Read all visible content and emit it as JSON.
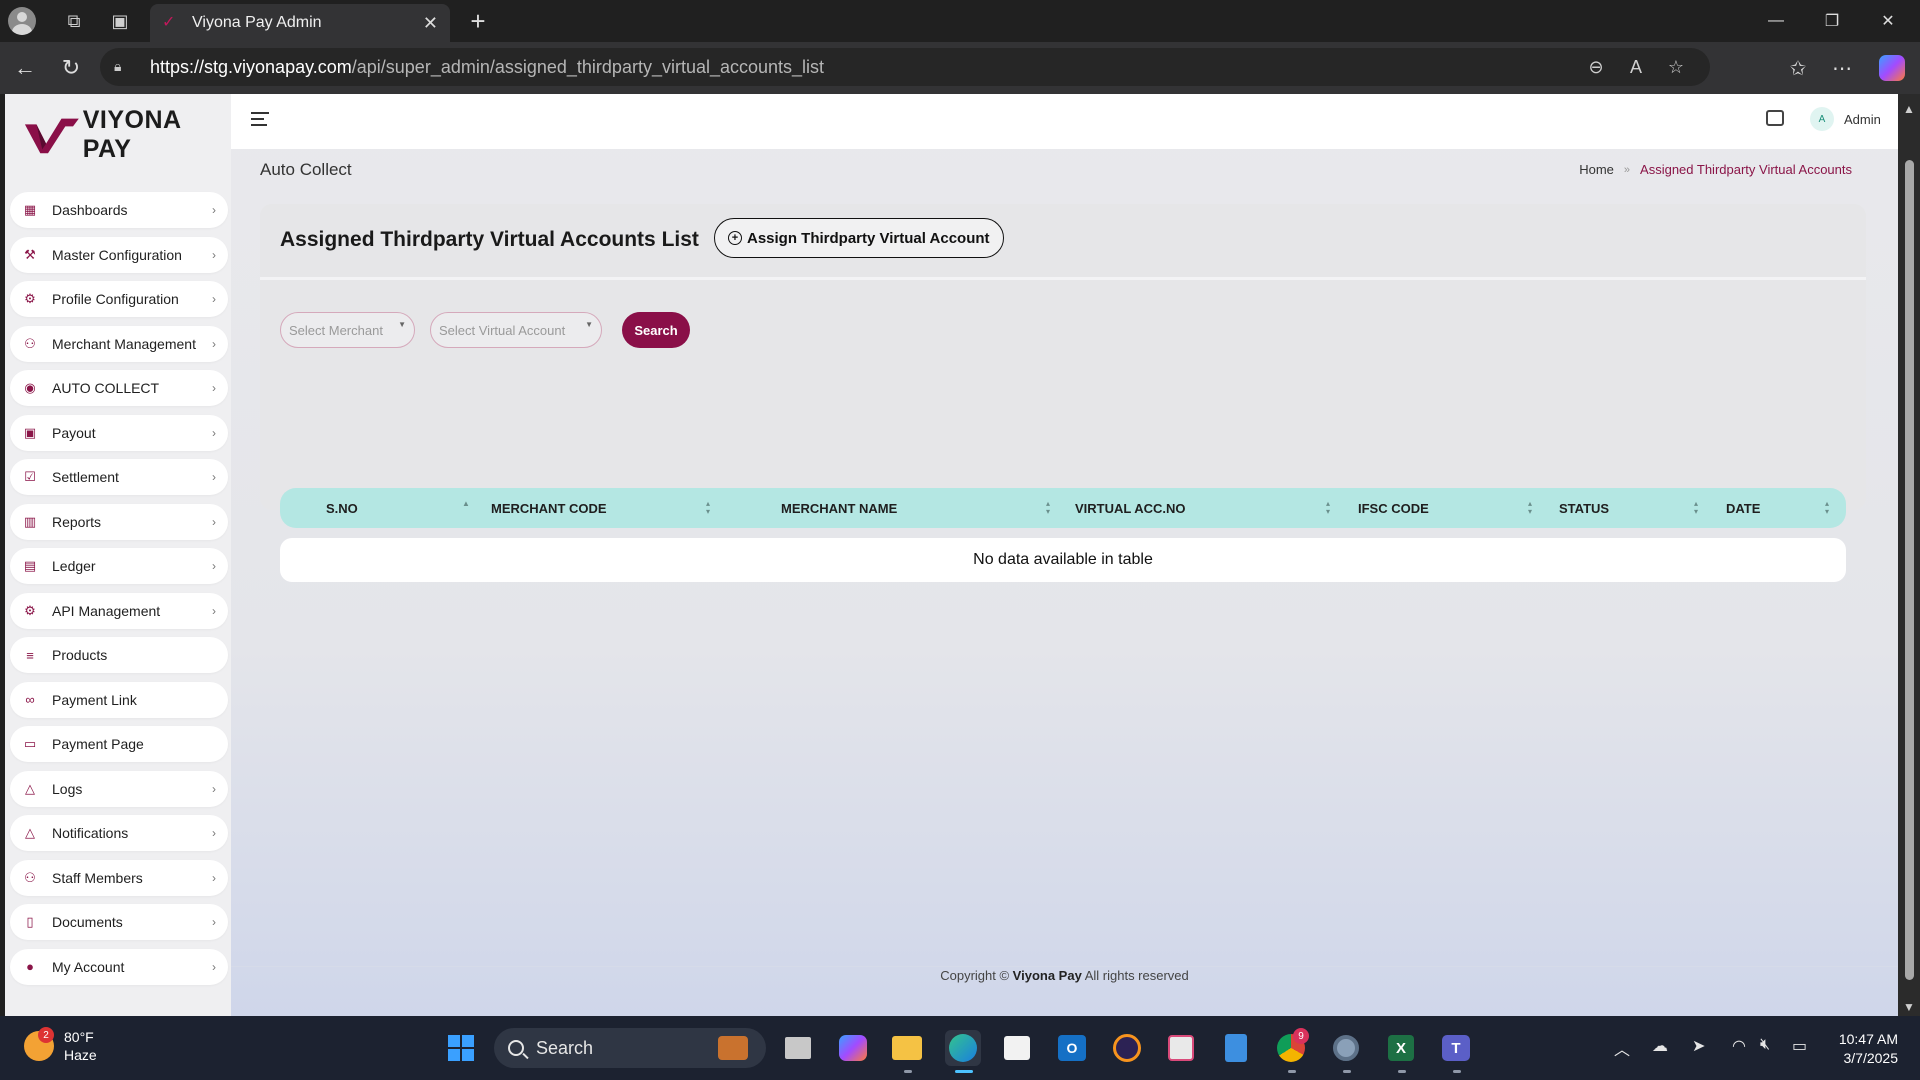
{
  "browser": {
    "tab_title": "Viyona Pay Admin",
    "url_host": "https://stg.viyonapay.com",
    "url_path": "/api/super_admin/assigned_thirdparty_virtual_accounts_list"
  },
  "brand": {
    "name": "VIYONA PAY",
    "accent": "#8a0f48"
  },
  "sidebar": {
    "items": [
      {
        "label": "Dashboards",
        "icon": "grid-icon",
        "glyph": "▦",
        "has_submenu": true
      },
      {
        "label": "Master Configuration",
        "icon": "wrench-icon",
        "glyph": "⚒",
        "has_submenu": true
      },
      {
        "label": "Profile Configuration",
        "icon": "gear-icon",
        "glyph": "⚙",
        "has_submenu": true
      },
      {
        "label": "Merchant Management",
        "icon": "users-icon",
        "glyph": "⚇",
        "has_submenu": true
      },
      {
        "label": "AUTO COLLECT",
        "icon": "refresh-icon",
        "glyph": "◉",
        "has_submenu": true
      },
      {
        "label": "Payout",
        "icon": "payout-icon",
        "glyph": "▣",
        "has_submenu": true
      },
      {
        "label": "Settlement",
        "icon": "calendar-check-icon",
        "glyph": "☑",
        "has_submenu": true
      },
      {
        "label": "Reports",
        "icon": "bar-chart-icon",
        "glyph": "▥",
        "has_submenu": true
      },
      {
        "label": "Ledger",
        "icon": "ledger-icon",
        "glyph": "▤",
        "has_submenu": true
      },
      {
        "label": "API Management",
        "icon": "cog-icon",
        "glyph": "⚙",
        "has_submenu": true
      },
      {
        "label": "Products",
        "icon": "list-plus-icon",
        "glyph": "≡",
        "has_submenu": false
      },
      {
        "label": "Payment Link",
        "icon": "link-icon",
        "glyph": "∞",
        "has_submenu": false
      },
      {
        "label": "Payment Page",
        "icon": "page-icon",
        "glyph": "▭",
        "has_submenu": false
      },
      {
        "label": "Logs",
        "icon": "bell-icon",
        "glyph": "△",
        "has_submenu": true
      },
      {
        "label": "Notifications",
        "icon": "bell-icon",
        "glyph": "△",
        "has_submenu": true
      },
      {
        "label": "Staff Members",
        "icon": "users-icon",
        "glyph": "⚇",
        "has_submenu": true
      },
      {
        "label": "Documents",
        "icon": "document-icon",
        "glyph": "▯",
        "has_submenu": true
      },
      {
        "label": "My Account",
        "icon": "user-circle-icon",
        "glyph": "●",
        "has_submenu": true
      }
    ]
  },
  "header": {
    "avatar_initial": "A",
    "user_name": "Admin"
  },
  "page": {
    "section_title": "Auto Collect",
    "breadcrumb": {
      "home": "Home",
      "current": "Assigned Thirdparty Virtual Accounts"
    },
    "card_title": "Assigned Thirdparty Virtual Accounts List",
    "assign_button": "Assign Thirdparty Virtual Account",
    "filters": {
      "merchant_placeholder": "Select Merchant",
      "virtual_account_placeholder": "Select Virtual Account",
      "search_label": "Search"
    },
    "table": {
      "columns": [
        "S.NO",
        "MERCHANT CODE",
        "MERCHANT NAME",
        "VIRTUAL ACC.NO",
        "IFSC CODE",
        "STATUS",
        "DATE"
      ],
      "empty_message": "No data available in table"
    }
  },
  "footer": {
    "prefix": "Copyright ©",
    "brand": "Viyona Pay",
    "suffix": "All rights reserved"
  },
  "taskbar": {
    "weather_temp": "80°F",
    "weather_desc": "Haze",
    "weather_badge": "2",
    "search_label": "Search",
    "chrome_badge": "9",
    "time": "10:47 AM",
    "date": "3/7/2025"
  }
}
